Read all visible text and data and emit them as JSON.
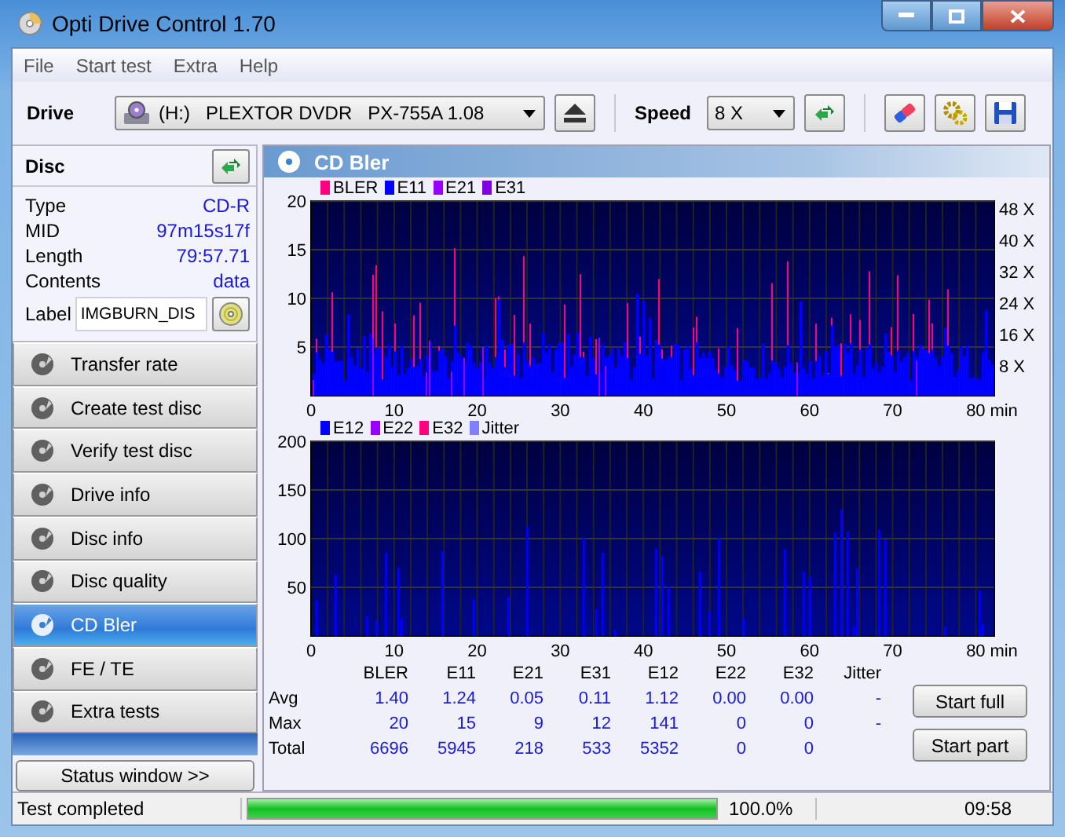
{
  "window": {
    "title": "Opti Drive Control 1.70"
  },
  "menu": [
    "File",
    "Start test",
    "Extra",
    "Help"
  ],
  "toolbar": {
    "drive_label": "Drive",
    "drive_value": "(H:)   PLEXTOR DVDR   PX-755A 1.08",
    "speed_label": "Speed",
    "speed_value": "8 X"
  },
  "disc": {
    "title": "Disc",
    "fields": [
      {
        "name": "Type",
        "value": "CD-R"
      },
      {
        "name": "MID",
        "value": "97m15s17f"
      },
      {
        "name": "Length",
        "value": "79:57.71"
      },
      {
        "name": "Contents",
        "value": "data"
      }
    ],
    "label_name": "Label",
    "label_value": "IMGBURN_DIS"
  },
  "sidebar": {
    "items": [
      {
        "label": "Transfer rate",
        "selected": false
      },
      {
        "label": "Create test disc",
        "selected": false
      },
      {
        "label": "Verify test disc",
        "selected": false
      },
      {
        "label": "Drive info",
        "selected": false
      },
      {
        "label": "Disc info",
        "selected": false
      },
      {
        "label": "Disc quality",
        "selected": false
      },
      {
        "label": "CD Bler",
        "selected": true
      },
      {
        "label": "FE / TE",
        "selected": false
      },
      {
        "label": "Extra tests",
        "selected": false
      }
    ],
    "status_button": "Status window >>"
  },
  "panel": {
    "title": "CD Bler"
  },
  "charts": [
    {
      "legend": [
        {
          "label": "BLER",
          "color": "#ff0080"
        },
        {
          "label": "E11",
          "color": "#0000ff"
        },
        {
          "label": "E21",
          "color": "#9900ff"
        },
        {
          "label": "E31",
          "color": "#8000e0"
        }
      ],
      "y_ticks": [
        "20",
        "15",
        "10",
        "5"
      ],
      "right_ticks": [
        "48 X",
        "40 X",
        "32 X",
        "24 X",
        "16 X",
        "8 X"
      ],
      "x_ticks": [
        "0",
        "10",
        "20",
        "30",
        "40",
        "50",
        "60",
        "70",
        "80"
      ],
      "x_unit": "min"
    },
    {
      "legend": [
        {
          "label": "E12",
          "color": "#0000ff"
        },
        {
          "label": "E22",
          "color": "#9900ff"
        },
        {
          "label": "E32",
          "color": "#ff0080"
        },
        {
          "label": "Jitter",
          "color": "#8080ff"
        }
      ],
      "y_ticks": [
        "200",
        "150",
        "100",
        "50"
      ],
      "x_ticks": [
        "0",
        "10",
        "20",
        "30",
        "40",
        "50",
        "60",
        "70",
        "80"
      ],
      "x_unit": "min"
    }
  ],
  "stats": {
    "columns": [
      "BLER",
      "E11",
      "E21",
      "E31",
      "E12",
      "E22",
      "E32",
      "Jitter"
    ],
    "rows": [
      {
        "label": "Avg",
        "values": [
          "1.40",
          "1.24",
          "0.05",
          "0.11",
          "1.12",
          "0.00",
          "0.00",
          "-"
        ]
      },
      {
        "label": "Max",
        "values": [
          "20",
          "15",
          "9",
          "12",
          "141",
          "0",
          "0",
          "-"
        ]
      },
      {
        "label": "Total",
        "values": [
          "6696",
          "5945",
          "218",
          "533",
          "5352",
          "0",
          "0"
        ]
      }
    ]
  },
  "buttons": [
    "Start full",
    "Start part"
  ],
  "status_bar": {
    "message": "Test completed",
    "level": 1.0,
    "percent": "100.0%",
    "time": "09:58"
  }
}
